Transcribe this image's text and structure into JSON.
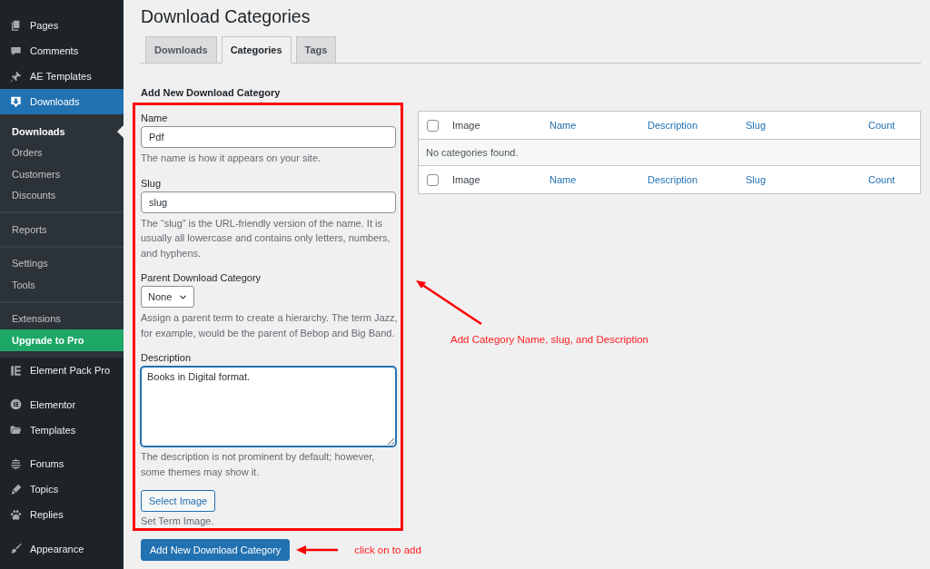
{
  "sidebar": {
    "sections": [
      {
        "items": [
          {
            "label": "Pages",
            "selected": false
          },
          {
            "label": "Comments",
            "selected": false
          },
          {
            "label": "AE Templates",
            "selected": false
          },
          {
            "label": "Downloads",
            "selected": true,
            "submenu_groups": [
              {
                "items": [
                  {
                    "label": "Downloads",
                    "kind": "link",
                    "selected": true
                  },
                  {
                    "label": "Orders",
                    "kind": "link",
                    "selected": false
                  },
                  {
                    "label": "Customers",
                    "kind": "link",
                    "selected": false
                  },
                  {
                    "label": "Discounts",
                    "kind": "link",
                    "selected": false
                  }
                ]
              },
              {
                "items": [
                  {
                    "label": "Reports",
                    "kind": "link",
                    "selected": false
                  }
                ]
              },
              {
                "items": [
                  {
                    "label": "Settings",
                    "kind": "link",
                    "selected": false
                  },
                  {
                    "label": "Tools",
                    "kind": "link",
                    "selected": false
                  }
                ]
              },
              {
                "items": [
                  {
                    "label": "Extensions",
                    "kind": "link",
                    "selected": false
                  },
                  {
                    "label": "Upgrade to Pro",
                    "kind": "promo",
                    "selected": false
                  }
                ]
              }
            ]
          },
          {
            "label": "Element Pack Pro",
            "selected": false
          }
        ]
      },
      {
        "items": [
          {
            "label": "Elementor",
            "selected": false
          },
          {
            "label": "Templates",
            "selected": false
          }
        ]
      },
      {
        "items": [
          {
            "label": "Forums",
            "selected": false
          },
          {
            "label": "Topics",
            "selected": false
          },
          {
            "label": "Replies",
            "selected": false
          }
        ]
      },
      {
        "items": [
          {
            "label": "Appearance",
            "selected": false
          }
        ]
      }
    ]
  },
  "page_title": "Download Categories",
  "tabs": [
    {
      "label": "Downloads",
      "selected": false
    },
    {
      "label": "Categories",
      "selected": true
    },
    {
      "label": "Tags",
      "selected": false
    }
  ],
  "form": {
    "heading": "Add New Download Category",
    "fields": [
      {
        "kind": "text",
        "label": "Name",
        "value": "Pdf",
        "focused": false,
        "help": "The name is how it appears on your site."
      },
      {
        "kind": "text",
        "label": "Slug",
        "value": "slug",
        "focused": false,
        "help": "The “slug” is the URL-friendly version of the name. It is usually all lowercase and contains only letters, numbers, and hyphens."
      },
      {
        "kind": "select",
        "label": "Parent Download Category",
        "value": "None",
        "focused": false,
        "help": "Assign a parent term to create a hierarchy. The term Jazz, for example, would be the parent of Bebop and Big Band."
      },
      {
        "kind": "textarea",
        "label": "Description",
        "value": "Books in Digital format.",
        "focused": true,
        "help": "The description is not prominent by default; however, some themes may show it."
      },
      {
        "kind": "image",
        "button": "Select Image",
        "help": "Set Term Image."
      }
    ],
    "submit_button": "Add New Download Category"
  },
  "table": {
    "header": {
      "checked": false,
      "columns": [
        {
          "label": "Image",
          "kind": "text"
        },
        {
          "label": "Name",
          "kind": "link"
        },
        {
          "label": "Description",
          "kind": "link"
        },
        {
          "label": "Slug",
          "kind": "link"
        },
        {
          "label": "Count",
          "kind": "link"
        }
      ]
    },
    "empty_message": "No categories found.",
    "footer": {
      "checked": false,
      "columns": [
        {
          "label": "Image",
          "kind": "text"
        },
        {
          "label": "Name",
          "kind": "link"
        },
        {
          "label": "Description",
          "kind": "link"
        },
        {
          "label": "Slug",
          "kind": "link"
        },
        {
          "label": "Count",
          "kind": "link"
        }
      ]
    }
  },
  "annotations": {
    "form_callout": "Add Category Name, slug, and Description",
    "submit_callout": "click on to add"
  }
}
